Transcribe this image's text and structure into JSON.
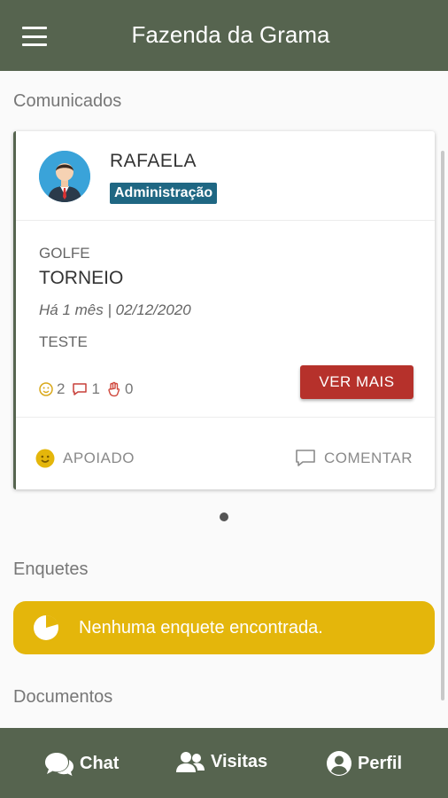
{
  "header": {
    "title": "Fazenda da Grama",
    "menu_icon": "hamburger-menu-icon"
  },
  "sections": {
    "comunicados": "Comunicados",
    "enquetes": "Enquetes",
    "documentos": "Documentos"
  },
  "post": {
    "author": "RAFAELA",
    "role": "Administração",
    "category": "GOLFE",
    "title": "TORNEIO",
    "date": "Há 1 mês | 02/12/2020",
    "body": "TESTE",
    "reactions": {
      "supports": "2",
      "comments": "1",
      "hands": "0"
    },
    "more_label": "VER MAIS",
    "support_label": "APOIADO",
    "comment_label": "COMENTAR"
  },
  "polls": {
    "empty_message": "Nenhuma enquete encontrada."
  },
  "nav": {
    "chat": "Chat",
    "visitas": "Visitas",
    "perfil": "Perfil"
  },
  "colors": {
    "bar": "#56644f",
    "badge": "#1f6783",
    "button": "#b6312b",
    "banner": "#e4b60b"
  }
}
